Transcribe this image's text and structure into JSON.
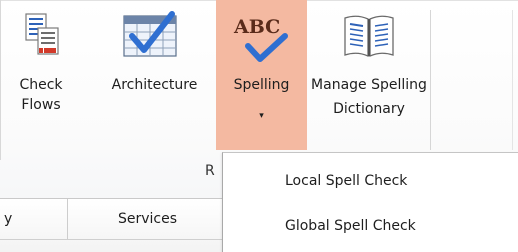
{
  "ribbon": {
    "buttons": [
      {
        "label_line1": "Check",
        "label_line2": "Flows",
        "icon": "check-flows-icon"
      },
      {
        "label_line1": "Architecture",
        "label_line2": "",
        "icon": "architecture-icon"
      },
      {
        "label_line1": "Spelling",
        "label_line2": "",
        "icon": "spelling-abc-icon",
        "icon_text": "ABC",
        "dropdown_glyph": "▾"
      },
      {
        "label_line1": "Manage Spelling",
        "label_line2": "Dictionary",
        "icon": "dictionary-book-icon"
      }
    ],
    "group_label_fragment": "R"
  },
  "grid": {
    "columns": [
      "y",
      "Services"
    ]
  },
  "dropdown": {
    "items": [
      "Local Spell Check",
      "Global Spell Check"
    ]
  },
  "colors": {
    "spelling_active_bg": "#f4b9a1",
    "checkmark_blue": "#2f6fd1",
    "abc_text": "#5a2b1a"
  }
}
